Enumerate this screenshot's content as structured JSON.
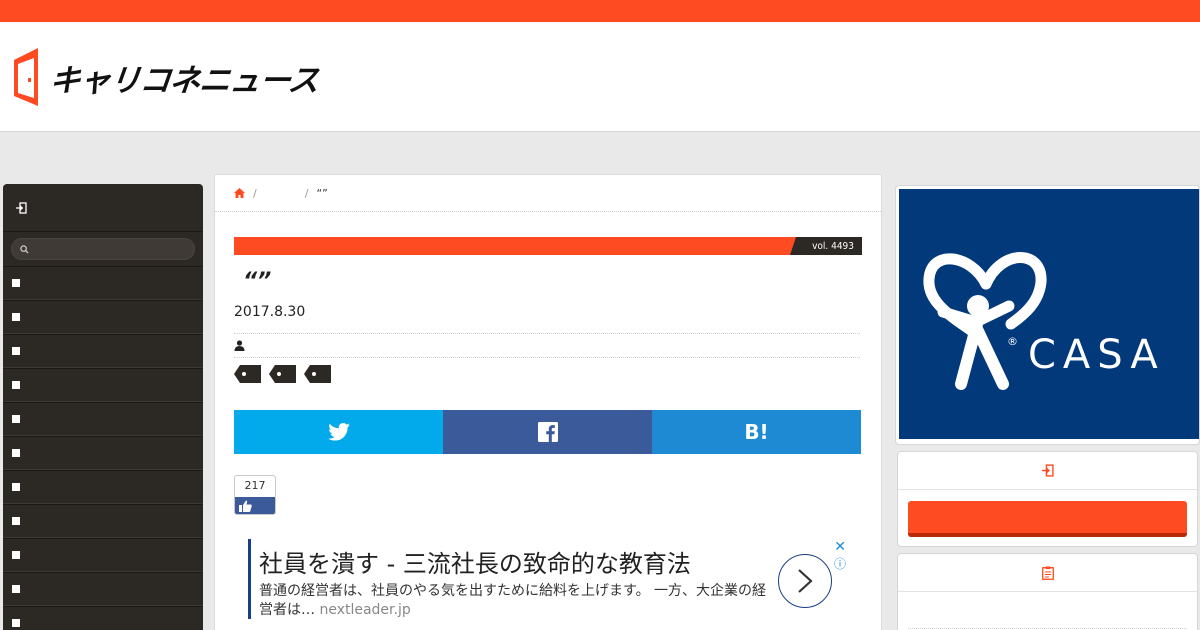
{
  "site": {
    "logo_text": "キャリコネニュース"
  },
  "left_nav": {
    "search_placeholder": "",
    "items": [
      "",
      "",
      "",
      "",
      "",
      "",
      "",
      "",
      "",
      "",
      ""
    ]
  },
  "breadcrumb": {
    "middle": "",
    "current": "“”"
  },
  "article": {
    "vol_label": "vol. 4493",
    "title": "“”",
    "date": "2017.8.30",
    "like_count": "217",
    "tag_count": 3
  },
  "share": {
    "twitter": "twitter-icon",
    "facebook": "facebook-icon",
    "hatena_label": "B!"
  },
  "ad": {
    "title": "社員を潰す - 三流社長の致命的な教育法",
    "description": "普通の経営者は、社員のやる気を出すために給料を上げます。 一方、大企業の経営者は…",
    "domain": "nextleader.jp",
    "close": "✕",
    "info": "ⓘ"
  },
  "right_banner": {
    "brand": "CASA",
    "mark": "®"
  },
  "colors": {
    "accent": "#ff4b22",
    "dark": "#2c2824",
    "casa_blue": "#02397a",
    "twitter": "#02aaec",
    "facebook": "#3b5a99",
    "hatena": "#1f8ad4"
  }
}
